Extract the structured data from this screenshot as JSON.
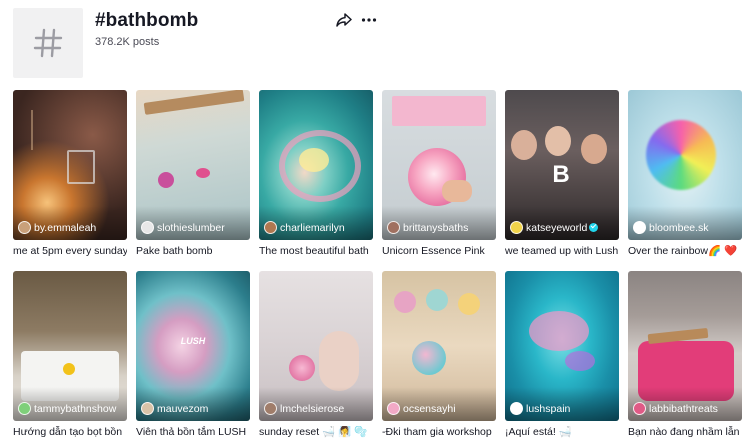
{
  "header": {
    "tag_icon": "hashtag-icon",
    "title": "#bathbomb",
    "posts_count": "378.2K posts",
    "share_icon": "share-icon",
    "more_icon": "more-dots-icon"
  },
  "videos": [
    {
      "username": "by.emmaleah",
      "caption": "me at 5pm every sunday",
      "verified": false,
      "overlay_text": ""
    },
    {
      "username": "slothieslumber",
      "caption": "Pake bath bomb",
      "verified": false,
      "overlay_text": ""
    },
    {
      "username": "charliemarilyn",
      "caption": "The most beautiful bath",
      "verified": false,
      "overlay_text": ""
    },
    {
      "username": "brittanysbaths",
      "caption": "Unicorn Essence Pink",
      "verified": false,
      "overlay_text": ""
    },
    {
      "username": "katseyeworld",
      "caption": "we teamed up with Lush",
      "verified": true,
      "overlay_text": ""
    },
    {
      "username": "bloombee.sk",
      "caption": "Over the rainbow🌈 ❤️",
      "verified": false,
      "overlay_text": ""
    },
    {
      "username": "tammybathnshow",
      "caption": "Hướng dẫn tạo bọt bồn",
      "verified": false,
      "overlay_text": ""
    },
    {
      "username": "mauvezom",
      "caption": "Viên thả bồn tắm LUSH",
      "verified": false,
      "overlay_text": "LUSH"
    },
    {
      "username": "lmchelsierose",
      "caption": "sunday reset 🛁 🧖‍♀️ 🫧",
      "verified": false,
      "overlay_text": ""
    },
    {
      "username": "ocsensayhi",
      "caption": "-Đki tham gia workshop",
      "verified": false,
      "overlay_text": ""
    },
    {
      "username": "lushspain",
      "caption": "¡Aquí está! 🛁",
      "verified": false,
      "overlay_text": ""
    },
    {
      "username": "labbibathtreats",
      "caption": "Bạn nào đang nhầm lẫn",
      "verified": false,
      "overlay_text": ""
    }
  ],
  "colors": {
    "text": "#161823",
    "muted": "#4a4a55",
    "verified": "#20d5ec",
    "avatar_bg": "#f1f1f2"
  }
}
